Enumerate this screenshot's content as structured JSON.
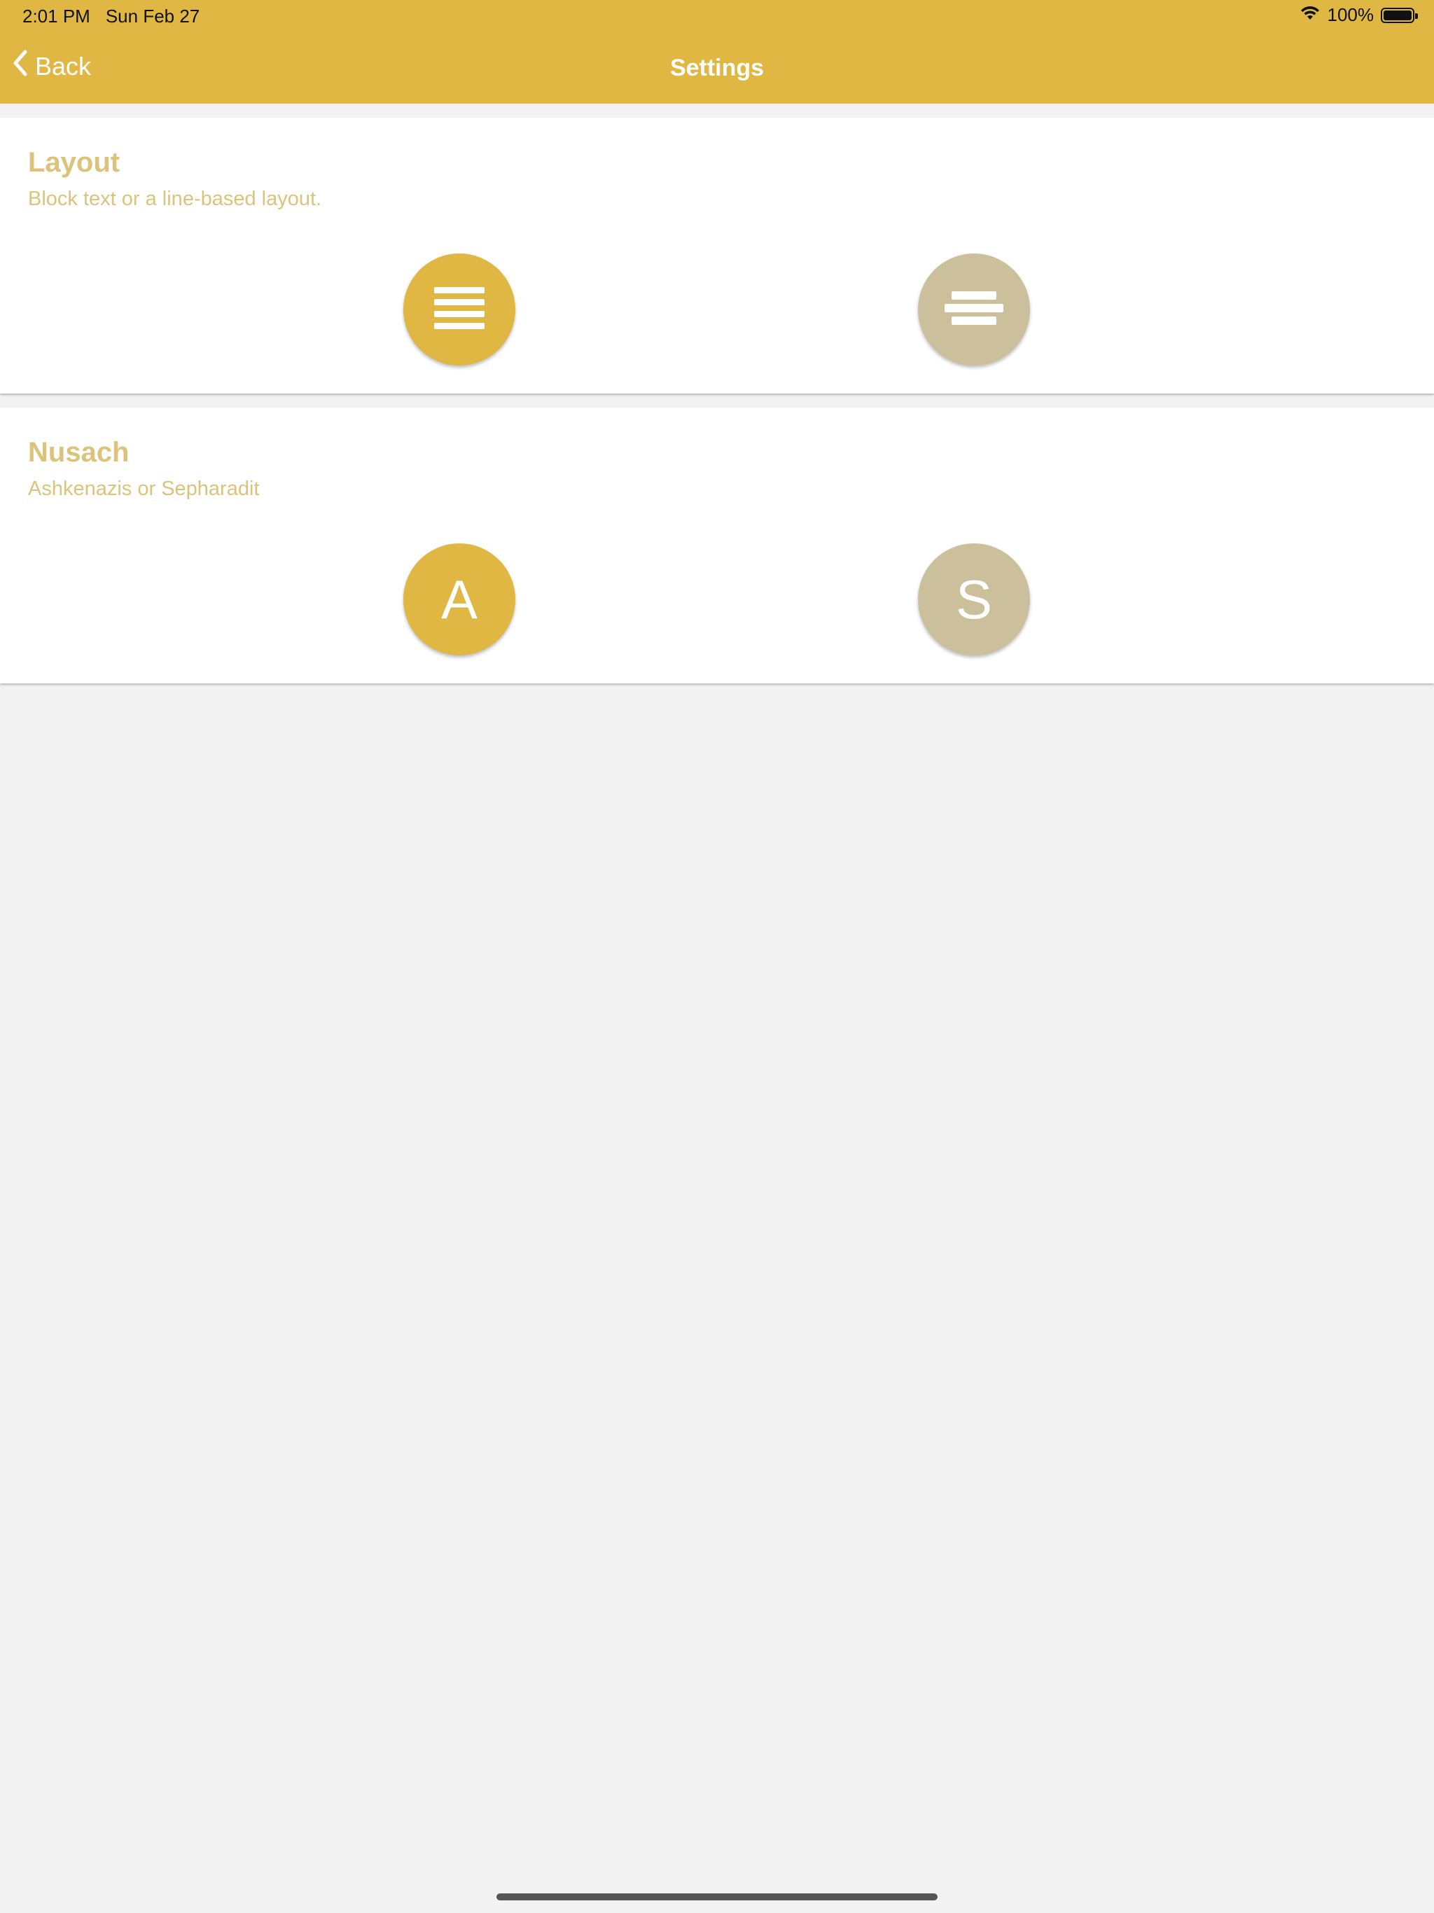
{
  "status_bar": {
    "time": "2:01 PM",
    "date": "Sun Feb 27",
    "battery_percent": "100%",
    "wifi_icon": "wifi-icon",
    "battery_icon": "battery-full-icon"
  },
  "nav": {
    "back_label": "Back",
    "title": "Settings",
    "back_icon": "chevron-left-icon"
  },
  "sections": {
    "layout": {
      "title": "Layout",
      "subtitle": "Block text or a line-based layout.",
      "options": [
        {
          "icon": "justify-text-icon",
          "selected": true
        },
        {
          "icon": "center-text-icon",
          "selected": false
        }
      ]
    },
    "nusach": {
      "title": "Nusach",
      "subtitle": "Ashkenazis or Sepharadit",
      "options": [
        {
          "letter": "A",
          "selected": true
        },
        {
          "letter": "S",
          "selected": false
        }
      ]
    }
  },
  "colors": {
    "accent": "#dfb742",
    "unselected": "#ccbf9b",
    "section_text": "#dcc37c",
    "background": "#f2f2f2"
  }
}
